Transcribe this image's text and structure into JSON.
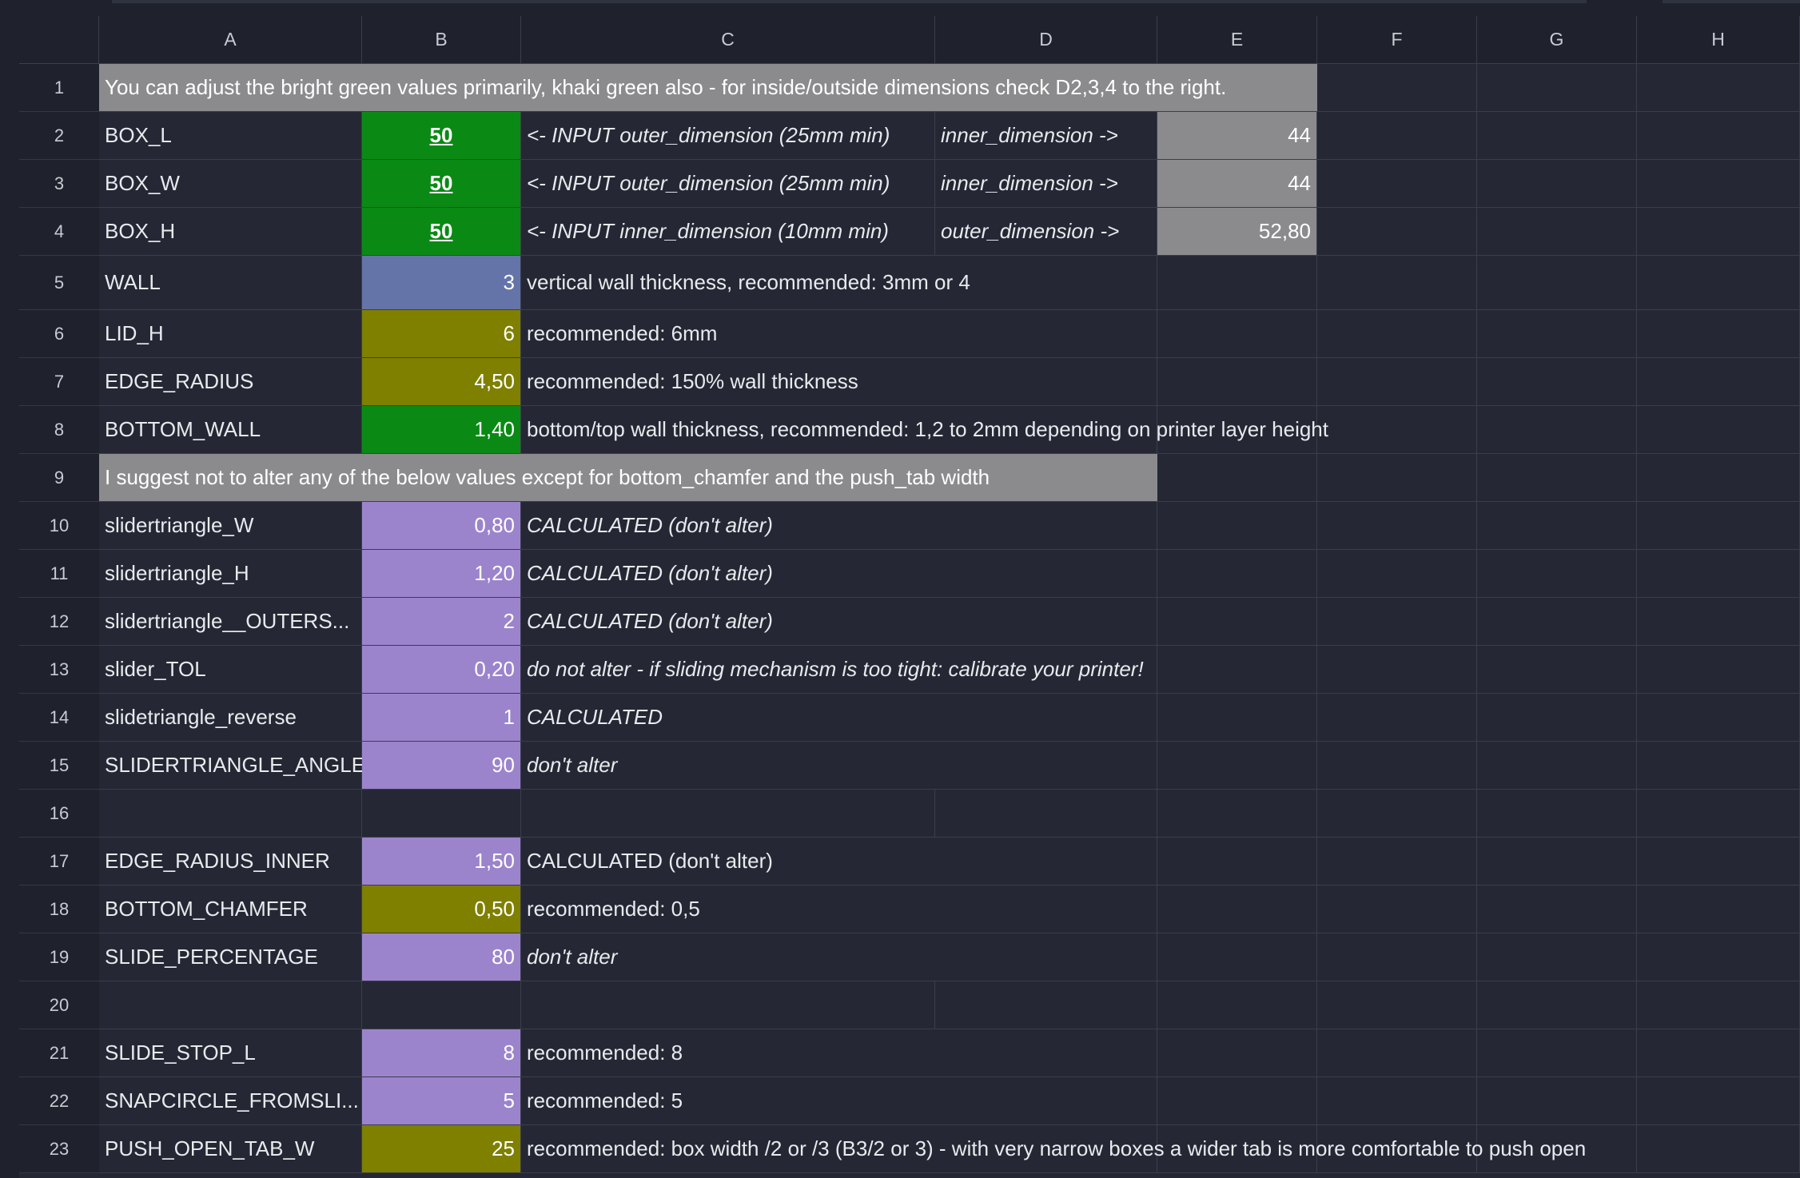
{
  "columns": [
    "A",
    "B",
    "C",
    "D",
    "E",
    "F",
    "G",
    "H"
  ],
  "rows": [
    "1",
    "2",
    "3",
    "4",
    "5",
    "6",
    "7",
    "8",
    "9",
    "10",
    "11",
    "12",
    "13",
    "14",
    "15",
    "16",
    "17",
    "18",
    "19",
    "20",
    "21",
    "22",
    "23"
  ],
  "notes": {
    "row1": "You can adjust the bright green values primarily, khaki green also - for inside/outside dimensions check D2,3,4 to the right.",
    "row9": "I suggest not to alter any of the below values except for bottom_chamfer and the push_tab width"
  },
  "cells": {
    "A2": "BOX_L",
    "B2": "50",
    "C2": "<- INPUT outer_dimension (25mm min)",
    "D2": "inner_dimension ->",
    "E2": "44",
    "A3": "BOX_W",
    "B3": "50",
    "C3": "<- INPUT outer_dimension (25mm min)",
    "D3": "inner_dimension ->",
    "E3": "44",
    "A4": "BOX_H",
    "B4": "50",
    "C4": "<- INPUT inner_dimension (10mm min)",
    "D4": "outer_dimension ->",
    "E4": "52,80",
    "A5": "WALL",
    "B5": "3",
    "C5": "vertical wall thickness, recommended: 3mm or 4",
    "A6": "LID_H",
    "B6": "6",
    "C6": "recommended: 6mm",
    "A7": "EDGE_RADIUS",
    "B7": "4,50",
    "C7": "recommended: 150% wall thickness",
    "A8": "BOTTOM_WALL",
    "B8": "1,40",
    "C8": "bottom/top wall thickness, recommended: 1,2 to 2mm depending on printer layer height",
    "A10": "slidertriangle_W",
    "B10": "0,80",
    "C10": "CALCULATED (don't alter)",
    "A11": "slidertriangle_H",
    "B11": "1,20",
    "C11": "CALCULATED (don't alter)",
    "A12": "slidertriangle__OUTERS...",
    "B12": "2",
    "C12": "CALCULATED (don't alter)",
    "A13": "slider_TOL",
    "B13": "0,20",
    "C13": "do not alter - if sliding mechanism is too tight: calibrate your printer!",
    "A14": "slidetriangle_reverse",
    "B14": "1",
    "C14": "CALCULATED",
    "A15": "SLIDERTRIANGLE_ANGLE",
    "B15": "90",
    "C15": "don't alter",
    "A17": "EDGE_RADIUS_INNER",
    "B17": "1,50",
    "C17": "CALCULATED (don't alter)",
    "A18": "BOTTOM_CHAMFER",
    "B18": "0,50",
    "C18": "recommended: 0,5",
    "A19": "SLIDE_PERCENTAGE",
    "B19": "80",
    "C19": "don't alter",
    "A21": "SLIDE_STOP_L",
    "B21": "8",
    "C21": "recommended: 8",
    "A22": "SNAPCIRCLE_FROMSLI...",
    "B22": "5",
    "C22": "recommended: 5",
    "A23": "PUSH_OPEN_TAB_W",
    "B23": "25",
    "C23": "recommended: box width /2 or /3 (B3/2 or 3) - with very narrow boxes a wider tab is more comfortable to push open"
  },
  "colors": {
    "green": "#0a8a14",
    "khaki": "#7f7f00",
    "blue": "#6574a8",
    "purple": "#9b84cc",
    "grey": "#8b8b8d",
    "background": "#252834"
  }
}
